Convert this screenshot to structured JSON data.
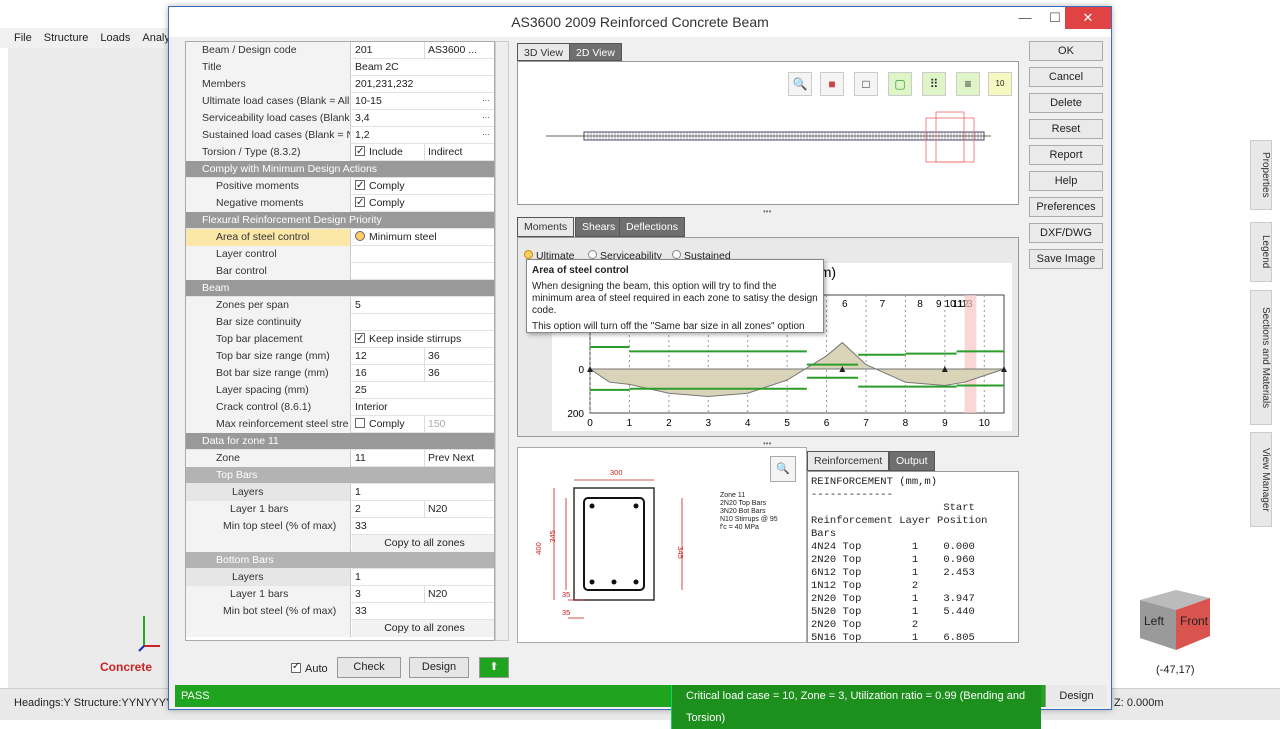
{
  "app": {
    "menu": [
      "File",
      "Structure",
      "Loads",
      "Analysis"
    ],
    "status_left": "Headings:Y Structure:YYNYYYYY Lo",
    "z_value": "Z: 0.000m",
    "coords": "(-47,17)",
    "concrete_label": "Concrete",
    "side_tabs": [
      "Properties",
      "Legend",
      "Sections and Materials",
      "View Manager"
    ],
    "cube_left": "Left",
    "cube_front": "Front"
  },
  "dialog": {
    "title": "AS3600 2009 Reinforced Concrete Beam",
    "minimize": "—",
    "maximize": "☐",
    "close": "✕"
  },
  "grid": {
    "rows": [
      {
        "type": "prop",
        "label": "Beam / Design code",
        "v1": "201",
        "v2": "AS3600 ..."
      },
      {
        "type": "prop",
        "label": "Title",
        "v1": "Beam 2C"
      },
      {
        "type": "prop",
        "label": "Members",
        "v1": "201,231,232"
      },
      {
        "type": "prop",
        "label": "Ultimate load cases (Blank = All",
        "v1": "10-15",
        "more": "···"
      },
      {
        "type": "prop",
        "label": "Serviceability load cases (Blank",
        "v1": "3,4",
        "more": "···"
      },
      {
        "type": "prop",
        "label": "Sustained load cases (Blank = N",
        "v1": "1,2",
        "more": "···"
      },
      {
        "type": "prop",
        "label": "Torsion / Type (8.3.2)",
        "chk": true,
        "v1": "Include",
        "v2": "Indirect"
      },
      {
        "type": "cat",
        "label": "Comply with Minimum Design Actions"
      },
      {
        "type": "prop",
        "label": "Positive moments",
        "chk": true,
        "v1": "Comply",
        "indent": 2
      },
      {
        "type": "prop",
        "label": "Negative moments",
        "chk": true,
        "v1": "Comply",
        "indent": 2
      },
      {
        "type": "cat",
        "label": "Flexural Reinforcement Design Priority"
      },
      {
        "type": "prop",
        "label": "Area of steel control",
        "radio": true,
        "v1": "Minimum steel",
        "sel": true,
        "indent": 2
      },
      {
        "type": "prop",
        "label": "Layer control",
        "indent": 2
      },
      {
        "type": "prop",
        "label": "Bar control",
        "indent": 2
      },
      {
        "type": "cat",
        "label": "Beam"
      },
      {
        "type": "prop",
        "label": "Zones per span",
        "v1": "5",
        "indent": 2
      },
      {
        "type": "prop",
        "label": "Bar size continuity",
        "indent": 2
      },
      {
        "type": "prop",
        "label": "Top bar placement",
        "chk": true,
        "v1": "Keep inside stirrups",
        "indent": 2
      },
      {
        "type": "prop",
        "label": "Top bar size range (mm)",
        "v1": "12",
        "v2": "36",
        "indent": 2
      },
      {
        "type": "prop",
        "label": "Bot bar size range (mm)",
        "v1": "16",
        "v2": "36",
        "indent": 2
      },
      {
        "type": "prop",
        "label": "Layer spacing (mm)",
        "v1": "25",
        "indent": 2
      },
      {
        "type": "prop",
        "label": "Crack control (8.6.1)",
        "v1": "Interior",
        "indent": 2
      },
      {
        "type": "prop",
        "label": "Max reinforcement steel stre",
        "chk": false,
        "v1": "Comply",
        "v2": "150",
        "indent": 2
      },
      {
        "type": "cat",
        "label": "Data for zone 11"
      },
      {
        "type": "prop",
        "label": "Zone",
        "v1": "11",
        "v2": "Prev  Next",
        "indent": 2
      },
      {
        "type": "sub",
        "label": "Top Bars"
      },
      {
        "type": "sub2",
        "label": "Layers",
        "v1": "1"
      },
      {
        "type": "prop",
        "label": "Layer 1 bars",
        "v1": "2",
        "v2": "N20",
        "indent": 4
      },
      {
        "type": "prop",
        "label": "Min top steel (% of max)",
        "v1": "33",
        "indent": 3
      },
      {
        "type": "prop",
        "label": "",
        "v1": "Copy to all zones",
        "center": true
      },
      {
        "type": "sub",
        "label": "Bottom Bars"
      },
      {
        "type": "sub2",
        "label": "Layers",
        "v1": "1"
      },
      {
        "type": "prop",
        "label": "Layer 1 bars",
        "v1": "3",
        "v2": "N20",
        "indent": 4
      },
      {
        "type": "prop",
        "label": "Min bot steel (% of max)",
        "v1": "33",
        "indent": 3
      },
      {
        "type": "prop",
        "label": "",
        "v1": "Copy to all zones",
        "center": true
      }
    ]
  },
  "viewer": {
    "tabs": [
      "3D View",
      "2D View"
    ],
    "results_tabs": [
      "Moments",
      "Shears",
      "Deflections"
    ],
    "radio": [
      "Ultimate",
      "Serviceability",
      "Sustained"
    ],
    "tooltip_title": "Area of steel control",
    "tooltip_body": "When designing the beam, this option will try to find the minimum area of steel required in each zone to satisy the design code.",
    "tooltip_note": "This option will turn off the \"Same bar size in all zones\" option"
  },
  "chart_data": {
    "type": "line",
    "title": "Moment (m,kNm)",
    "x_ticks": [
      0,
      1,
      2,
      3,
      4,
      5,
      6,
      7,
      8,
      9,
      10
    ],
    "zone_labels": [
      "3",
      "4",
      "5",
      "6",
      "7",
      "8",
      "9",
      "10",
      "11",
      "12",
      "13"
    ],
    "y_ticks": [
      0,
      200
    ],
    "series": [
      {
        "x": [
          0,
          0.5,
          1,
          2,
          3,
          4,
          5,
          6,
          6.4,
          7,
          8,
          9,
          9.5,
          10,
          10.5
        ],
        "values": [
          0,
          -60,
          -70,
          -110,
          -125,
          -110,
          -50,
          60,
          120,
          20,
          -60,
          -75,
          -60,
          -30,
          0
        ]
      }
    ]
  },
  "section": {
    "dims": [
      "300",
      "400",
      "345",
      "345",
      "35",
      "35"
    ],
    "notes": [
      "Zone 11",
      "2N20 Top Bars",
      "3N20 Bot Bars",
      "N10 Stirrups @ 95",
      "f'c = 40 MPa"
    ]
  },
  "output": {
    "tabs": [
      "Reinforcement",
      "Output"
    ],
    "text": "REINFORCEMENT (mm,m)\n-------------\n                     Start\nReinforcement Layer Position\nBars\n4N24 Top        1    0.000\n2N20 Top        1    0.960\n6N12 Top        1    2.453\n1N12 Top        2\n2N20 Top        1    3.947\n5N20 Top        1    5.440\n2N20 Top        2\n5N16 Top        1    6.805"
  },
  "buttons": {
    "side": [
      "OK",
      "Cancel",
      "Delete",
      "Reset",
      "Report",
      "Help",
      "Preferences",
      "DXF/DWG",
      "Save Image"
    ],
    "auto_label": "Auto",
    "check": "Check",
    "design": "Design"
  },
  "status": {
    "pass": "PASS",
    "message": "Critical load case = 10, Zone = 3, Utilization ratio = 0.99 (Bending and Torsion)",
    "design": "Design"
  }
}
